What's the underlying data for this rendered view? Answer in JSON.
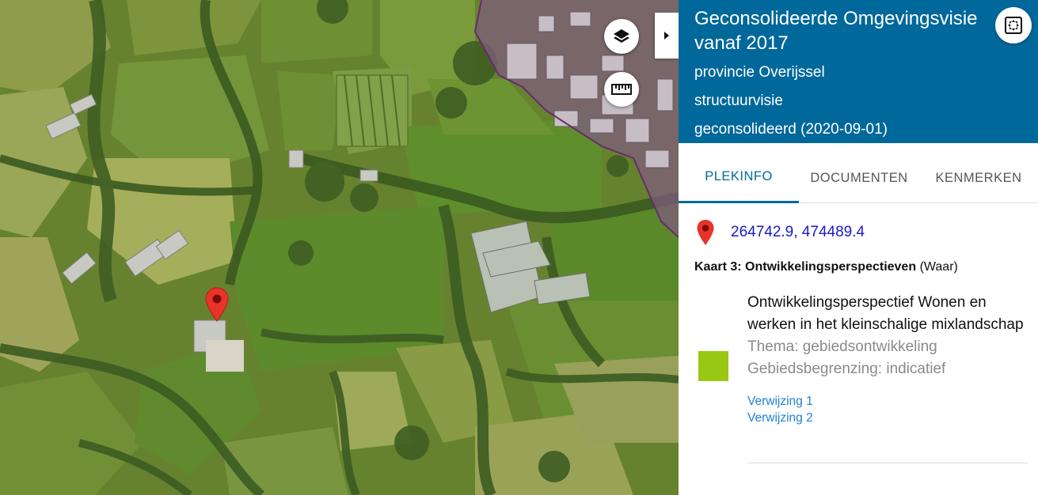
{
  "map": {
    "layers_button": "layers-icon",
    "measure_button": "ruler-icon",
    "collapse_button": "chevron-right-icon",
    "marker": "map-marker-icon",
    "colors": {
      "meadow": "#5f8a2a",
      "urban_overlay": "#8c5c8c",
      "marker": "#e8332a"
    }
  },
  "panel": {
    "header": {
      "title": "Geconsolideerde Omgevingsvisie vanaf 2017",
      "authority": "provincie Overijssel",
      "type": "structuurvisie",
      "status": "geconsolideerd (2020-09-01)",
      "fullscreen_icon": "fullscreen-icon",
      "color": "#01689b"
    },
    "tabs": [
      {
        "label": "PLEKINFO",
        "active": true
      },
      {
        "label": "DOCUMENTEN",
        "active": false
      },
      {
        "label": "KENMERKEN",
        "active": false
      }
    ],
    "coordinates": "264742.9, 474489.4",
    "map_title": {
      "name": "Kaart 3: Ontwikkelingsperspectieven",
      "status": "(Waar)"
    },
    "legend": {
      "name": "Ontwikkelingsperspectief Wonen en werken in het kleinschalige mixlandschap",
      "thema": "Thema: gebiedsontwikkeling",
      "begrenzing": "Gebiedsbegrenzing: indicatief",
      "color": "#98c814",
      "references": [
        "Verwijzing 1",
        "Verwijzing 2"
      ]
    }
  }
}
